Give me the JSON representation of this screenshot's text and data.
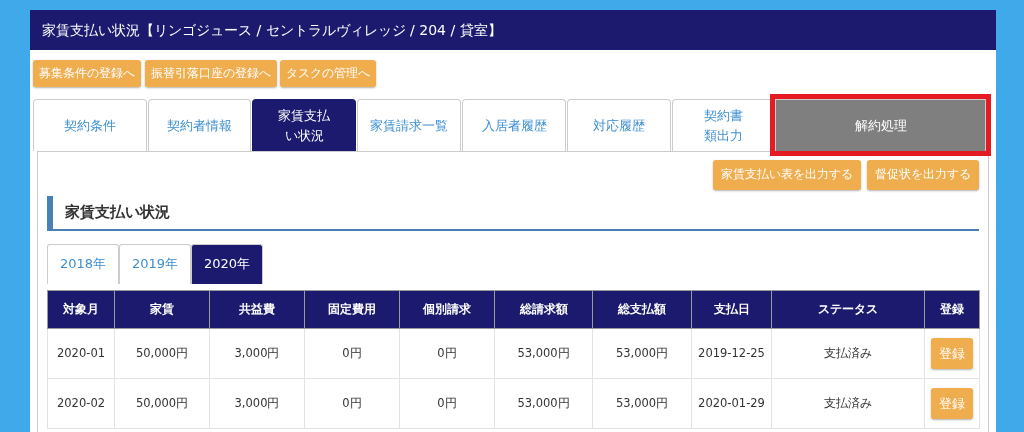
{
  "window": {
    "title": "家賃支払い状況【リンゴジュース / セントラルヴィレッジ / 204 / 貸室】"
  },
  "nav_buttons": [
    "募集条件の登録へ",
    "振替引落口座の登録へ",
    "タスクの管理へ"
  ],
  "tabs": [
    {
      "label": "契約条件",
      "selected": false,
      "kind": "normal"
    },
    {
      "label": "契約者情報",
      "selected": false,
      "kind": "normal"
    },
    {
      "label": "家賃支払い状況",
      "selected": true,
      "kind": "normal"
    },
    {
      "label": "家賃請求一覧",
      "selected": false,
      "kind": "normal"
    },
    {
      "label": "入居者履歴",
      "selected": false,
      "kind": "normal"
    },
    {
      "label": "対応履歴",
      "selected": false,
      "kind": "normal"
    },
    {
      "label": "契約書類出力",
      "selected": false,
      "kind": "normal"
    },
    {
      "label": "解約処理",
      "selected": false,
      "kind": "cancel",
      "highlighted": true
    }
  ],
  "output_buttons": [
    "家賃支払い表を出力する",
    "督促状を出力する"
  ],
  "section_title": "家賃支払い状況",
  "year_tabs": [
    {
      "label": "2018年",
      "selected": false
    },
    {
      "label": "2019年",
      "selected": false
    },
    {
      "label": "2020年",
      "selected": true
    }
  ],
  "table": {
    "columns": [
      "対象月",
      "家賃",
      "共益費",
      "固定費用",
      "個別請求",
      "総請求額",
      "総支払額",
      "支払日",
      "ステータス",
      "登録"
    ],
    "rows": [
      {
        "cells": [
          "2020-01",
          "50,000円",
          "3,000円",
          "0円",
          "0円",
          "53,000円",
          "53,000円",
          "2019-12-25",
          "支払済み"
        ],
        "button": "登録"
      },
      {
        "cells": [
          "2020-02",
          "50,000円",
          "3,000円",
          "0円",
          "0円",
          "53,000円",
          "53,000円",
          "2020-01-29",
          "支払済み"
        ],
        "button": "登録"
      }
    ]
  }
}
